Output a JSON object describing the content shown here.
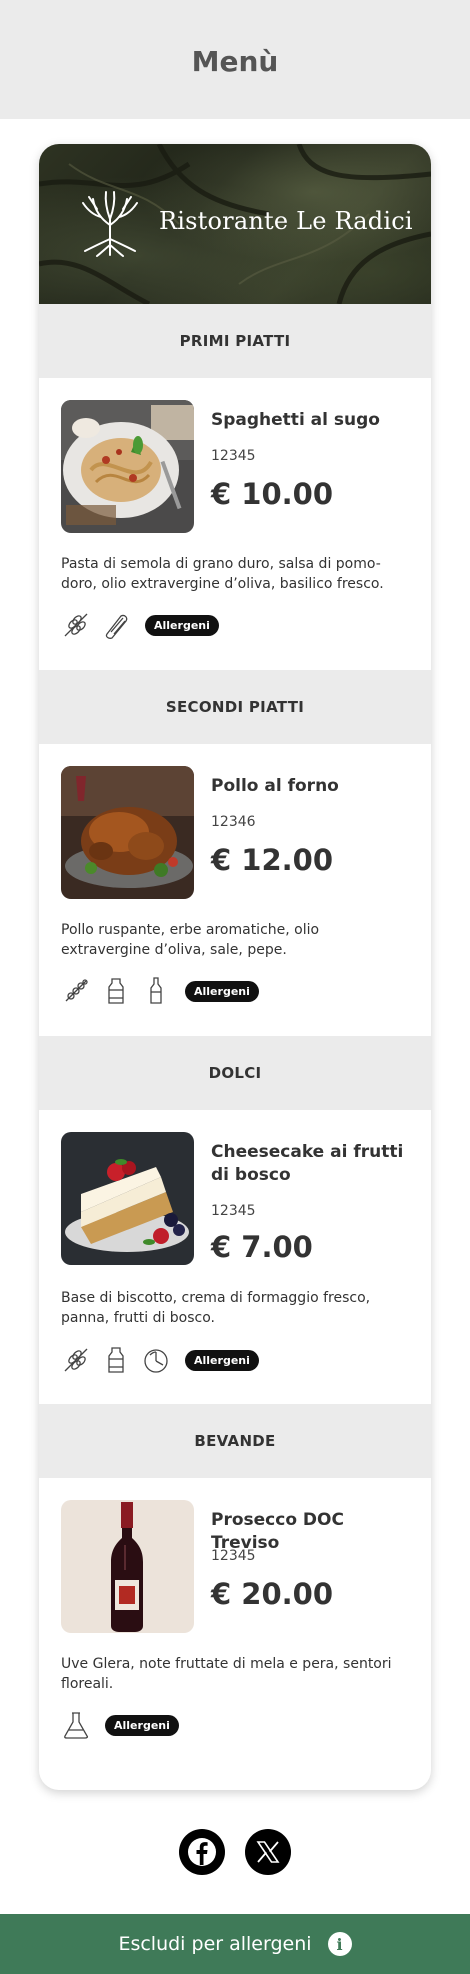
{
  "header": {
    "title": "Menù"
  },
  "restaurant": {
    "name": "Ristorante Le Radici"
  },
  "sections": [
    {
      "title": "PRIMI PIATTI",
      "dish": {
        "name": "Spaghetti al sugo",
        "code": "12345",
        "price": "€ 10.00",
        "description": "Pasta di semola di grano duro, salsa di pomo-doro, olio extravergine d’oliva, basilico fresco.",
        "allergen_icons": [
          "wheat-icon",
          "celery-icon"
        ],
        "allergens_label": "Allergeni"
      }
    },
    {
      "title": "SECONDI PIATTI",
      "dish": {
        "name": "Pollo al forno",
        "code": "12346",
        "price": "€ 12.00",
        "description": "Pollo ruspante, erbe aromatiche, olio extravergine d’oliva, sale, pepe.",
        "allergen_icons": [
          "mustard-icon",
          "milk-bottle-icon",
          "sauce-bottle-icon"
        ],
        "allergens_label": "Allergeni"
      }
    },
    {
      "title": "DOLCI",
      "dish": {
        "name": "Cheesecake ai frutti di bosco",
        "code": "12345",
        "price": "€ 7.00",
        "description": "Base di biscotto, crema di formaggio fresco, panna, frutti di bosco.",
        "allergen_icons": [
          "wheat-icon",
          "milk-bottle-icon",
          "lupin-icon"
        ],
        "allergens_label": "Allergeni"
      }
    },
    {
      "title": "BEVANDE",
      "dish": {
        "name": "Prosecco DOC Treviso",
        "code": "12345",
        "price": "€ 20.00",
        "description": "Uve Glera, note fruttate di mela e pera, sentori floreali.",
        "allergen_icons": [
          "sulphites-flask-icon"
        ],
        "allergens_label": "Allergeni"
      }
    }
  ],
  "social": [
    "facebook-icon",
    "x-icon"
  ],
  "footer": {
    "label": "Escludi per allergeni"
  },
  "colors": {
    "footer_green": "#3f7a58",
    "section_bg": "#ebebeb"
  }
}
